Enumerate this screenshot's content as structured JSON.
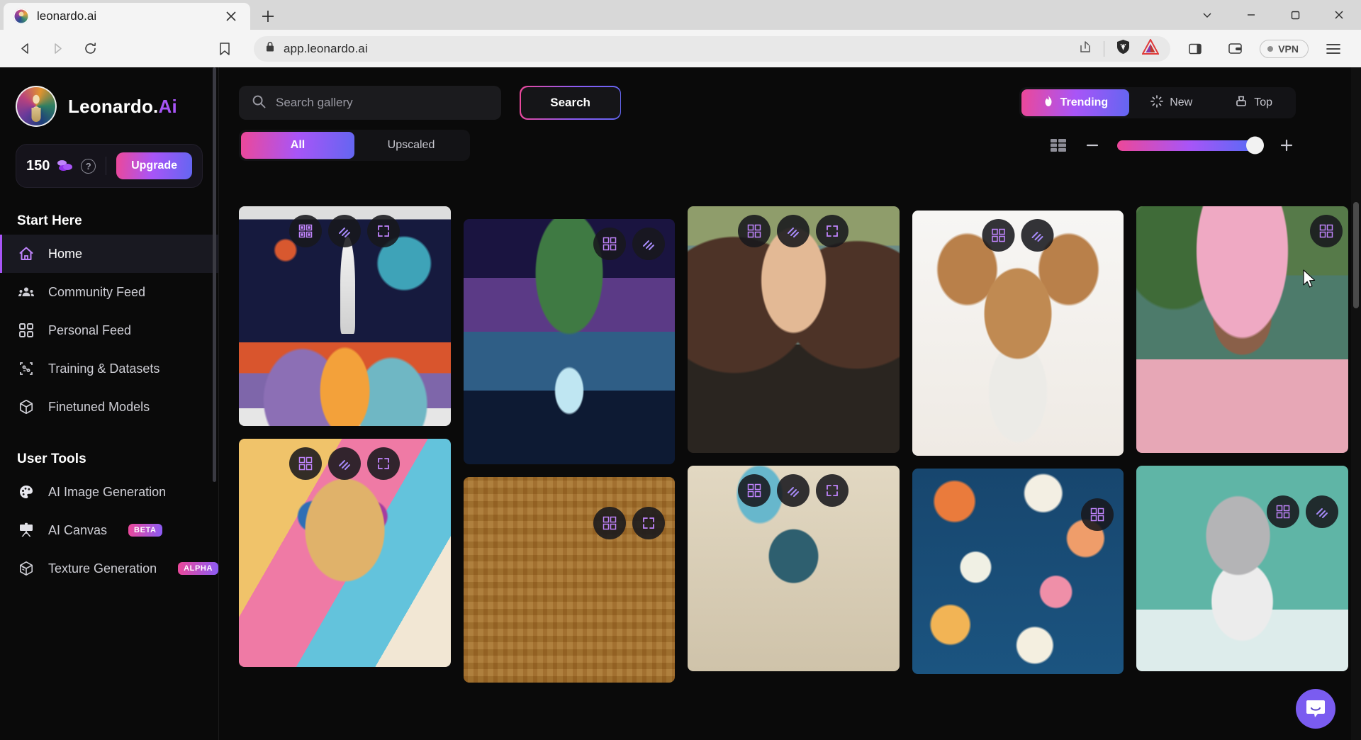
{
  "browser": {
    "tab": {
      "title": "leonardo.ai",
      "favicon_icon": "leonardo-favicon",
      "close_icon": "close-icon"
    },
    "new_tab_label": "+",
    "window_controls": {
      "chevron_icon": "chevron-down-icon",
      "minimize_icon": "minimize-icon",
      "maximize_icon": "maximize-icon",
      "close_icon": "close-icon"
    },
    "nav": {
      "back_icon": "back-arrow-icon",
      "forward_icon": "forward-arrow-icon",
      "reload_icon": "reload-icon",
      "bookmark_icon": "bookmark-icon"
    },
    "omnibox": {
      "lock_icon": "lock-icon",
      "url": "app.leonardo.ai",
      "share_icon": "share-icon",
      "brave_shields_icon": "brave-lion-shield-icon",
      "bat_rewards_icon": "brave-rewards-triangle-icon"
    },
    "toolbar_right": {
      "sidebar_icon": "sidebar-panel-icon",
      "wallet_icon": "wallet-icon",
      "vpn_label": "VPN",
      "menu_icon": "hamburger-menu-icon"
    }
  },
  "sidebar": {
    "brand": {
      "name": "Leonardo.",
      "suffix": "Ai",
      "logo_icon": "leonardo-avatar-logo"
    },
    "credits": {
      "amount": "150",
      "coin_icon": "coin-stack-icon",
      "help_icon": "help-circle-icon",
      "upgrade_label": "Upgrade"
    },
    "sections": [
      {
        "title": "Start Here",
        "items": [
          {
            "label": "Home",
            "icon": "home-icon",
            "active": true,
            "badge": ""
          },
          {
            "label": "Community Feed",
            "icon": "community-people-icon",
            "active": false,
            "badge": ""
          },
          {
            "label": "Personal Feed",
            "icon": "grid-squares-icon",
            "active": false,
            "badge": ""
          },
          {
            "label": "Training & Datasets",
            "icon": "training-datasets-icon",
            "active": false,
            "badge": ""
          },
          {
            "label": "Finetuned Models",
            "icon": "cube-icon",
            "active": false,
            "badge": ""
          }
        ]
      },
      {
        "title": "User Tools",
        "items": [
          {
            "label": "AI Image Generation",
            "icon": "palette-icon",
            "active": false,
            "badge": ""
          },
          {
            "label": "AI Canvas",
            "icon": "easel-icon",
            "active": false,
            "badge": "BETA"
          },
          {
            "label": "Texture Generation",
            "icon": "texture-cube-icon",
            "active": false,
            "badge": "ALPHA"
          }
        ]
      }
    ]
  },
  "main": {
    "search": {
      "placeholder": "Search gallery",
      "value": "",
      "icon": "search-icon",
      "button_label": "Search"
    },
    "filters": [
      {
        "label": "All",
        "active": true
      },
      {
        "label": "Upscaled",
        "active": false
      }
    ],
    "sort": [
      {
        "label": "Trending",
        "icon": "flame-icon",
        "active": true
      },
      {
        "label": "New",
        "icon": "sparkle-icon",
        "active": false
      },
      {
        "label": "Top",
        "icon": "trophy-icon",
        "active": false
      }
    ],
    "view_controls": {
      "grid_icon": "grid-density-icon",
      "zoom_out_label": "−",
      "zoom_in_label": "+",
      "slider_value": "100"
    },
    "card_actions": [
      {
        "icon": "image-to-image-icon",
        "label": ""
      },
      {
        "icon": "upscale-diagonal-icon",
        "label": ""
      },
      {
        "icon": "expand-fullscreen-icon",
        "label": ""
      }
    ],
    "gallery": {
      "columns": [
        {
          "cards": [
            {
              "name": "rocket-launch-illustration",
              "art": "a-rocket",
              "actions": 3
            },
            {
              "name": "lion-sunglasses-illustration",
              "art": "a-lion",
              "actions": 3
            }
          ]
        },
        {
          "cards": [
            {
              "name": "cosmic-tree-waterfall",
              "art": "a-tree",
              "actions": 2
            },
            {
              "name": "egyptian-hieroglyphs",
              "art": "a-hiero",
              "actions": 2
            }
          ]
        },
        {
          "cards": [
            {
              "name": "woman-portrait-beach",
              "art": "a-woman",
              "actions": 3
            },
            {
              "name": "blue-haired-sorceress",
              "art": "a-sorceress",
              "actions": 3
            }
          ]
        },
        {
          "cards": [
            {
              "name": "chihuahua-watercolor",
              "art": "a-dog",
              "actions": 2
            },
            {
              "name": "floral-pattern",
              "art": "a-floral",
              "actions": 1
            }
          ]
        },
        {
          "cards": [
            {
              "name": "pink-hair-fairy-portrait",
              "art": "a-fairy",
              "actions": 1
            },
            {
              "name": "koala-on-bicycle",
              "art": "a-koala",
              "actions": 2
            }
          ]
        }
      ]
    },
    "intercom": {
      "icon": "intercom-chat-icon",
      "color": "#7a5cf0"
    }
  },
  "colors": {
    "accent_pink": "#ec4899",
    "accent_purple": "#a855f7",
    "accent_blue": "#6366f1",
    "bg_dark": "#0a0a0a",
    "panel": "#131316"
  }
}
